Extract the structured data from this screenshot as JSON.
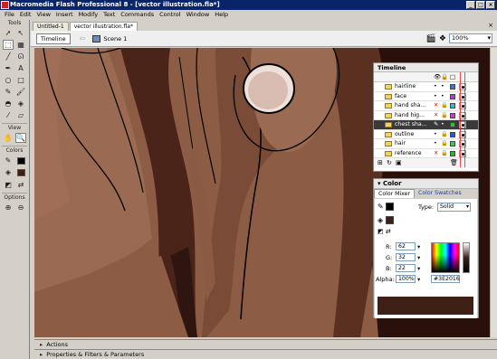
{
  "window": {
    "title": "Macromedia Flash Professional 8 - [vector illustration.fla*]"
  },
  "menu": [
    "File",
    "Edit",
    "View",
    "Insert",
    "Modify",
    "Text",
    "Commands",
    "Control",
    "Window",
    "Help"
  ],
  "tools": {
    "sections": {
      "tools": "Tools",
      "view": "View",
      "colors": "Colors",
      "options": "Options"
    }
  },
  "doc_tabs": [
    {
      "label": "Untitled-1"
    },
    {
      "label": "vector illustration.fla*"
    }
  ],
  "edit_bar": {
    "timeline_label": "Timeline",
    "scene_label": "Scene 1",
    "zoom": "100%"
  },
  "timeline": {
    "title": "Timeline",
    "layers": [
      {
        "name": "hairline",
        "locked": false,
        "color": "#4a6ed0"
      },
      {
        "name": "face",
        "locked": false,
        "color": "#b040d0"
      },
      {
        "name": "hand sha...",
        "locked": true,
        "color": "#30c0c0"
      },
      {
        "name": "hand hig...",
        "locked": true,
        "color": "#d040d0"
      },
      {
        "name": "chest sha...",
        "locked": false,
        "color": "#30c030",
        "selected": true
      },
      {
        "name": "outline",
        "locked": false,
        "color": "#3050e0"
      },
      {
        "name": "hair",
        "locked": false,
        "color": "#30d060"
      },
      {
        "name": "reference",
        "locked": true,
        "color": "#20c020"
      }
    ]
  },
  "color_panel": {
    "title": "Color",
    "tabs": [
      "Color Mixer",
      "Color Swatches"
    ],
    "type_label": "Type:",
    "type_value": "Solid",
    "r_label": "R:",
    "r": "62",
    "g_label": "G:",
    "g": "32",
    "b_label": "B:",
    "b": "22",
    "alpha_label": "Alpha:",
    "alpha": "100%",
    "hex": "#3E2016",
    "fill_color": "#3e2016"
  },
  "bottom_panels": [
    {
      "label": "Actions"
    },
    {
      "label": "Properties & Filters & Parameters"
    }
  ],
  "colors": {
    "skin_base": "#8c5c45",
    "skin_dark": "#5a3020",
    "skin_darkest": "#2e1510",
    "eye_white": "#e8d6d0"
  }
}
